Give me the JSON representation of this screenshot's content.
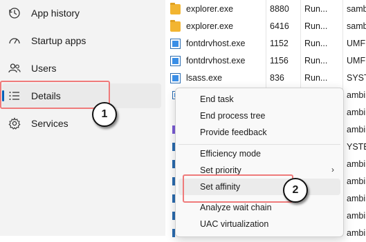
{
  "sidebar": {
    "items": [
      {
        "label": "App history",
        "icon": "history-icon"
      },
      {
        "label": "Startup apps",
        "icon": "speedometer-icon"
      },
      {
        "label": "Users",
        "icon": "users-icon"
      },
      {
        "label": "Details",
        "icon": "list-icon",
        "selected": true
      },
      {
        "label": "Services",
        "icon": "gear-icon"
      }
    ]
  },
  "processes": [
    {
      "name": "explorer.exe",
      "pid": "8880",
      "status": "Run...",
      "user": "sambi",
      "icon": "folder-icon"
    },
    {
      "name": "explorer.exe",
      "pid": "6416",
      "status": "Run...",
      "user": "sambi",
      "icon": "folder-icon"
    },
    {
      "name": "fontdrvhost.exe",
      "pid": "1152",
      "status": "Run...",
      "user": "UMFD-",
      "icon": "window-icon"
    },
    {
      "name": "fontdrvhost.exe",
      "pid": "1156",
      "status": "Run...",
      "user": "UMFD-",
      "icon": "window-icon"
    },
    {
      "name": "lsass.exe",
      "pid": "836",
      "status": "Run...",
      "user": "SYSTEM",
      "icon": "window-icon"
    }
  ],
  "hidden_rows_user": [
    "ambi",
    "ambi",
    "ambi",
    "YSTEM",
    "ambi",
    "ambi",
    "ambi",
    "ambi",
    "ambi",
    "ambi"
  ],
  "context_menu": {
    "items": [
      {
        "label": "End task"
      },
      {
        "label": "End process tree"
      },
      {
        "label": "Provide feedback"
      },
      {
        "label": "Efficiency mode"
      },
      {
        "label": "Set priority",
        "submenu": "›"
      },
      {
        "label": "Set affinity"
      },
      {
        "label": "Analyze wait chain"
      },
      {
        "label": "UAC virtualization"
      }
    ]
  },
  "annotations": {
    "step1": "1",
    "step2": "2"
  },
  "colors": {
    "accent": "#005fb8",
    "annotation": "#ef7a7a"
  }
}
